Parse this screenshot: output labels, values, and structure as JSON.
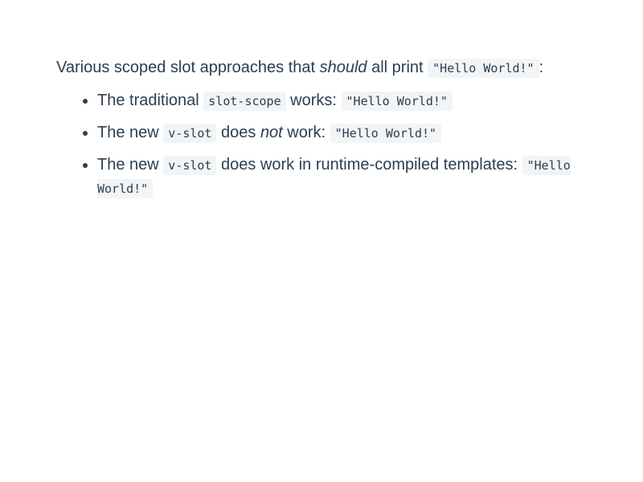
{
  "intro": {
    "text_before": "Various scoped slot approaches that ",
    "emphasis": "should",
    "text_middle": " all print ",
    "code": "\"Hello World!\"",
    "text_after": ":"
  },
  "items": [
    {
      "prefix": "The traditional ",
      "code1": "slot-scope",
      "middle": " works: ",
      "result": "\"Hello World!\""
    },
    {
      "prefix": "The new ",
      "code1": "v-slot",
      "middle_before_em": " does ",
      "emphasis": "not",
      "middle": " work: ",
      "result": "\"Hello World!\""
    },
    {
      "prefix": "The new ",
      "code1": "v-slot",
      "middle": " does work in runtime-compiled templates: ",
      "result": "\"Hello World!\""
    }
  ]
}
